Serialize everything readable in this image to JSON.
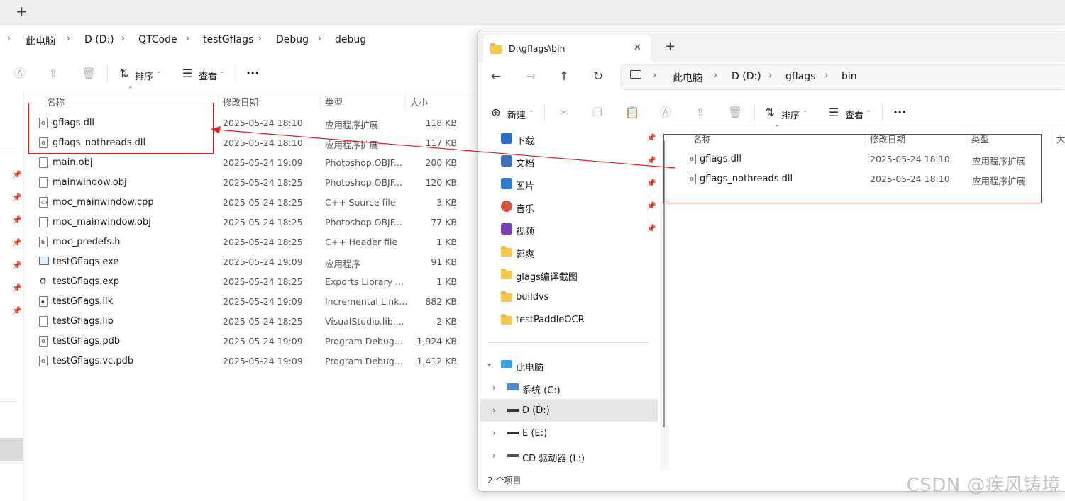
{
  "back_window": {
    "new_tab_label": "+",
    "breadcrumbs": [
      "此电脑",
      "D (D:)",
      "QTCode",
      "testGflags",
      "Debug",
      "debug"
    ],
    "toolbar": {
      "sort_label": "排序",
      "view_label": "查看",
      "more_label": "···"
    },
    "columns": {
      "name": "名称",
      "date": "修改日期",
      "type": "类型",
      "size": "大小"
    },
    "files": [
      {
        "name": "gflags.dll",
        "date": "2025-05-24 18:10",
        "type": "应用程序扩展",
        "size": "118 KB",
        "icon": "dll-file-icon"
      },
      {
        "name": "gflags_nothreads.dll",
        "date": "2025-05-24 18:10",
        "type": "应用程序扩展",
        "size": "117 KB",
        "icon": "dll-file-icon"
      },
      {
        "name": "main.obj",
        "date": "2025-05-24 19:09",
        "type": "Photoshop.OBJF...",
        "size": "200 KB",
        "icon": "file-icon"
      },
      {
        "name": "mainwindow.obj",
        "date": "2025-05-24 18:25",
        "type": "Photoshop.OBJF...",
        "size": "120 KB",
        "icon": "file-icon"
      },
      {
        "name": "moc_mainwindow.cpp",
        "date": "2025-05-24 18:25",
        "type": "C++ Source file",
        "size": "3 KB",
        "icon": "cpp-file-icon"
      },
      {
        "name": "moc_mainwindow.obj",
        "date": "2025-05-24 18:25",
        "type": "Photoshop.OBJF...",
        "size": "77 KB",
        "icon": "file-icon"
      },
      {
        "name": "moc_predefs.h",
        "date": "2025-05-24 18:25",
        "type": "C++ Header file",
        "size": "1 KB",
        "icon": "header-file-icon"
      },
      {
        "name": "testGflags.exe",
        "date": "2025-05-24 19:09",
        "type": "应用程序",
        "size": "91 KB",
        "icon": "exe-file-icon"
      },
      {
        "name": "testGflags.exp",
        "date": "2025-05-24 18:25",
        "type": "Exports Library ...",
        "size": "1 KB",
        "icon": "exp-file-icon"
      },
      {
        "name": "testGflags.ilk",
        "date": "2025-05-24 19:09",
        "type": "Incremental Link...",
        "size": "882 KB",
        "icon": "ilk-file-icon"
      },
      {
        "name": "testGflags.lib",
        "date": "2025-05-24 18:25",
        "type": "VisualStudio.lib....",
        "size": "2 KB",
        "icon": "file-icon"
      },
      {
        "name": "testGflags.pdb",
        "date": "2025-05-24 19:09",
        "type": "Program Debug...",
        "size": "1,924 KB",
        "icon": "pdb-file-icon"
      },
      {
        "name": "testGflags.vc.pdb",
        "date": "2025-05-24 19:09",
        "type": "Program Debug...",
        "size": "1,412 KB",
        "icon": "pdb-file-icon"
      }
    ]
  },
  "front_window": {
    "tab_title": "D:\\gflags\\bin",
    "tab_close": "✕",
    "new_tab_label": "+",
    "breadcrumbs": [
      "此电脑",
      "D (D:)",
      "gflags",
      "bin"
    ],
    "toolbar": {
      "new_label": "新建",
      "sort_label": "排序",
      "view_label": "查看",
      "more_label": "···"
    },
    "columns": {
      "name": "名称",
      "date": "修改日期",
      "type": "类型",
      "size": "大"
    },
    "files": [
      {
        "name": "gflags.dll",
        "date": "2025-05-24 18:10",
        "type": "应用程序扩展",
        "icon": "dll-file-icon"
      },
      {
        "name": "gflags_nothreads.dll",
        "date": "2025-05-24 18:10",
        "type": "应用程序扩展",
        "icon": "dll-file-icon"
      }
    ],
    "quick_access": [
      {
        "label": "下载",
        "icon": "download-icon",
        "pinned": true
      },
      {
        "label": "文档",
        "icon": "documents-icon",
        "pinned": true
      },
      {
        "label": "图片",
        "icon": "pictures-icon",
        "pinned": true
      },
      {
        "label": "音乐",
        "icon": "music-icon",
        "pinned": true
      },
      {
        "label": "视频",
        "icon": "videos-icon",
        "pinned": true
      },
      {
        "label": "郭爽",
        "icon": "folder-icon",
        "pinned": false
      },
      {
        "label": "glags编译截图",
        "icon": "folder-icon",
        "pinned": false
      },
      {
        "label": "buildvs",
        "icon": "folder-icon",
        "pinned": false
      },
      {
        "label": "testPaddleOCR",
        "icon": "folder-icon",
        "pinned": false
      }
    ],
    "this_pc": {
      "label": "此电脑",
      "drives": [
        {
          "label": "系统 (C:)",
          "selected": false
        },
        {
          "label": "D (D:)",
          "selected": true
        },
        {
          "label": "E (E:)",
          "selected": false
        },
        {
          "label": "CD 驱动器 (L:)",
          "selected": false
        }
      ]
    },
    "status_text": "2 个项目"
  },
  "watermark": "CSDN @疾风铸境",
  "colors": {
    "highlight_red": "#e02020",
    "folder_yellow": "#f6c94a",
    "selected_row": "#e5e5e5"
  }
}
